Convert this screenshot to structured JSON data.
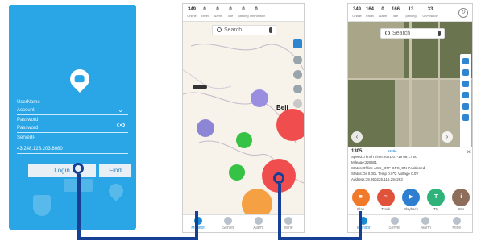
{
  "login": {
    "username_label": "UserName",
    "account_placeholder": "Account",
    "password_label": "Password",
    "password_placeholder": "Password",
    "server_label": "ServerIP",
    "server_value": "43.248.128.203:8080",
    "login_button": "Login",
    "find_button": "Find"
  },
  "map_screen": {
    "stats": [
      {
        "value": "349",
        "label": "Online"
      },
      {
        "value": "0",
        "label": "travel"
      },
      {
        "value": "0",
        "label": "Alarm"
      },
      {
        "value": "0",
        "label": "Idle"
      },
      {
        "value": "0",
        "label": "parking"
      },
      {
        "value": "0",
        "label": "UnPosition"
      }
    ],
    "search_placeholder": "Search",
    "city_label": "Beij",
    "footer_text": "地图数据 ©2022 高德软件 GS京(2022)",
    "tabs": [
      "Monitor",
      "Server",
      "Alarm",
      "Mine"
    ]
  },
  "satellite_screen": {
    "stats": [
      {
        "value": "349",
        "label": "Online"
      },
      {
        "value": "164",
        "label": "travel"
      },
      {
        "value": "0",
        "label": "Alarm"
      },
      {
        "value": "166",
        "label": "Idle"
      },
      {
        "value": "13",
        "label": "parking"
      },
      {
        "value": "33",
        "label": "UnPosition"
      }
    ],
    "search_placeholder": "Search",
    "panel": {
      "device": "1305",
      "status_badge": "static",
      "close": "×",
      "rows": [
        "Speed:0 km/h   Time:2021-07-19 08:17:00",
        "Mileage:226591",
        "Status:Offline ACC_OFF GPS_ON Positioned",
        "Status:Oil 0.00L Temp 0.0℃ Voltage 0.0V",
        "Address:39.950226,116.294263"
      ]
    },
    "actions": [
      {
        "label": "Play",
        "color": "#f07a2a",
        "glyph": "■"
      },
      {
        "label": "Track",
        "color": "#e0523a",
        "glyph": "≈"
      },
      {
        "label": "Playback",
        "color": "#2f7fd1",
        "glyph": "▶"
      },
      {
        "label": "Ttc",
        "color": "#2fb37a",
        "glyph": "T"
      },
      {
        "label": "Info",
        "color": "#8e6e5a",
        "glyph": "i"
      }
    ],
    "tabs": [
      "Monitor",
      "Server",
      "Alarm",
      "Mine"
    ]
  },
  "colors": {
    "login_bg": "#2aa6e6",
    "accent": "#1a8ad4",
    "connector": "#163f96"
  }
}
